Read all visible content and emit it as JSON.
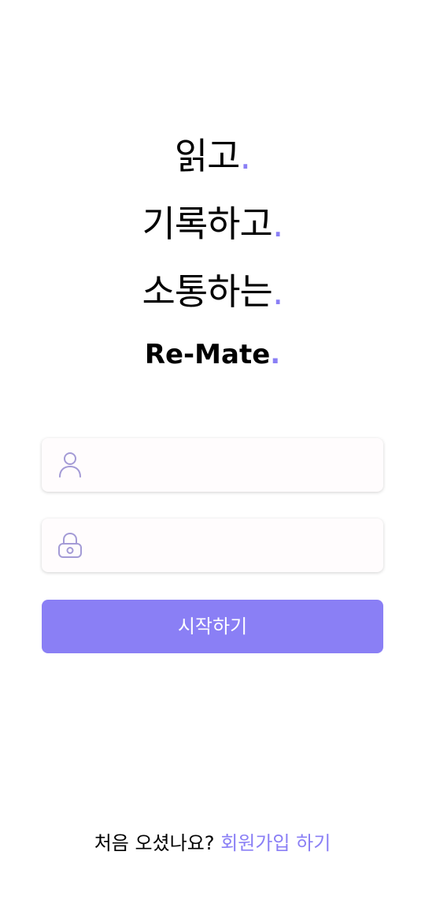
{
  "slogan": {
    "line1": "읽고",
    "line2": "기록하고",
    "line3": "소통하는",
    "dot": "."
  },
  "brand": {
    "name": "Re-Mate",
    "dot": "."
  },
  "login": {
    "username_placeholder": "",
    "password_placeholder": "",
    "username_icon": "user-icon",
    "password_icon": "lock-icon",
    "start_label": "시작하기"
  },
  "signup": {
    "question": "처음 오셨나요?",
    "link_label": "회원가입 하기"
  },
  "colors": {
    "accent": "#8a7ff5",
    "icon": "#a49bd6",
    "text": "#000000",
    "field_bg": "#fffcfd"
  }
}
